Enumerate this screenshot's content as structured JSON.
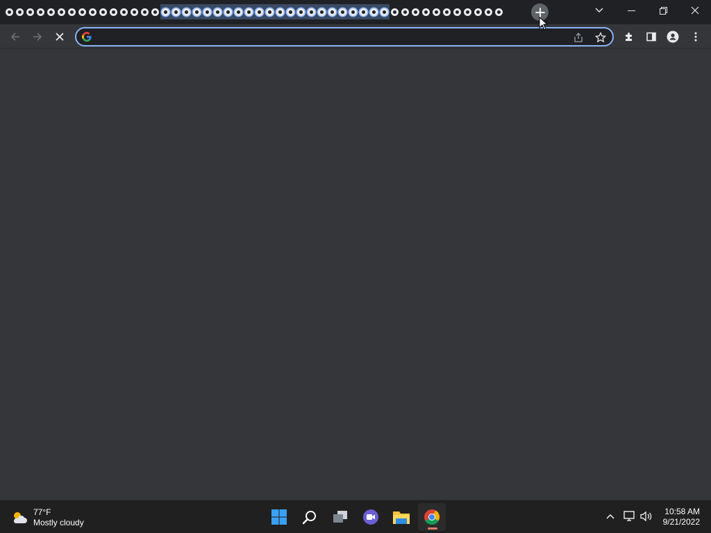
{
  "browser": {
    "tabs_wide_count": 15,
    "tabs_narrow_count": 33,
    "new_tab_icon": "plus-icon",
    "window_controls": [
      "tab-search-icon",
      "minimize-icon",
      "restore-icon",
      "close-icon"
    ]
  },
  "toolbar": {
    "back_icon": "arrow-left-icon",
    "forward_icon": "arrow-right-icon",
    "stop_icon": "close-icon",
    "address_value": "",
    "address_placeholder": "",
    "share_icon": "share-icon",
    "bookmark_icon": "star-icon",
    "extensions_icon": "puzzle-icon",
    "sidepanel_icon": "side-panel-icon",
    "profile_icon": "person-icon",
    "menu_icon": "kebab-icon"
  },
  "taskbar": {
    "weather_temp": "77°F",
    "weather_condition": "Mostly cloudy",
    "apps": [
      "start-icon",
      "search-icon",
      "task-view-icon",
      "teams-chat-icon",
      "file-explorer-icon",
      "chrome-icon"
    ],
    "clock_time": "10:58 AM",
    "clock_date": "9/21/2022"
  },
  "colors": {
    "frame": "#202124",
    "toolbar": "#35363a",
    "accent": "#8ab4f8",
    "taskbar": "#202020"
  }
}
